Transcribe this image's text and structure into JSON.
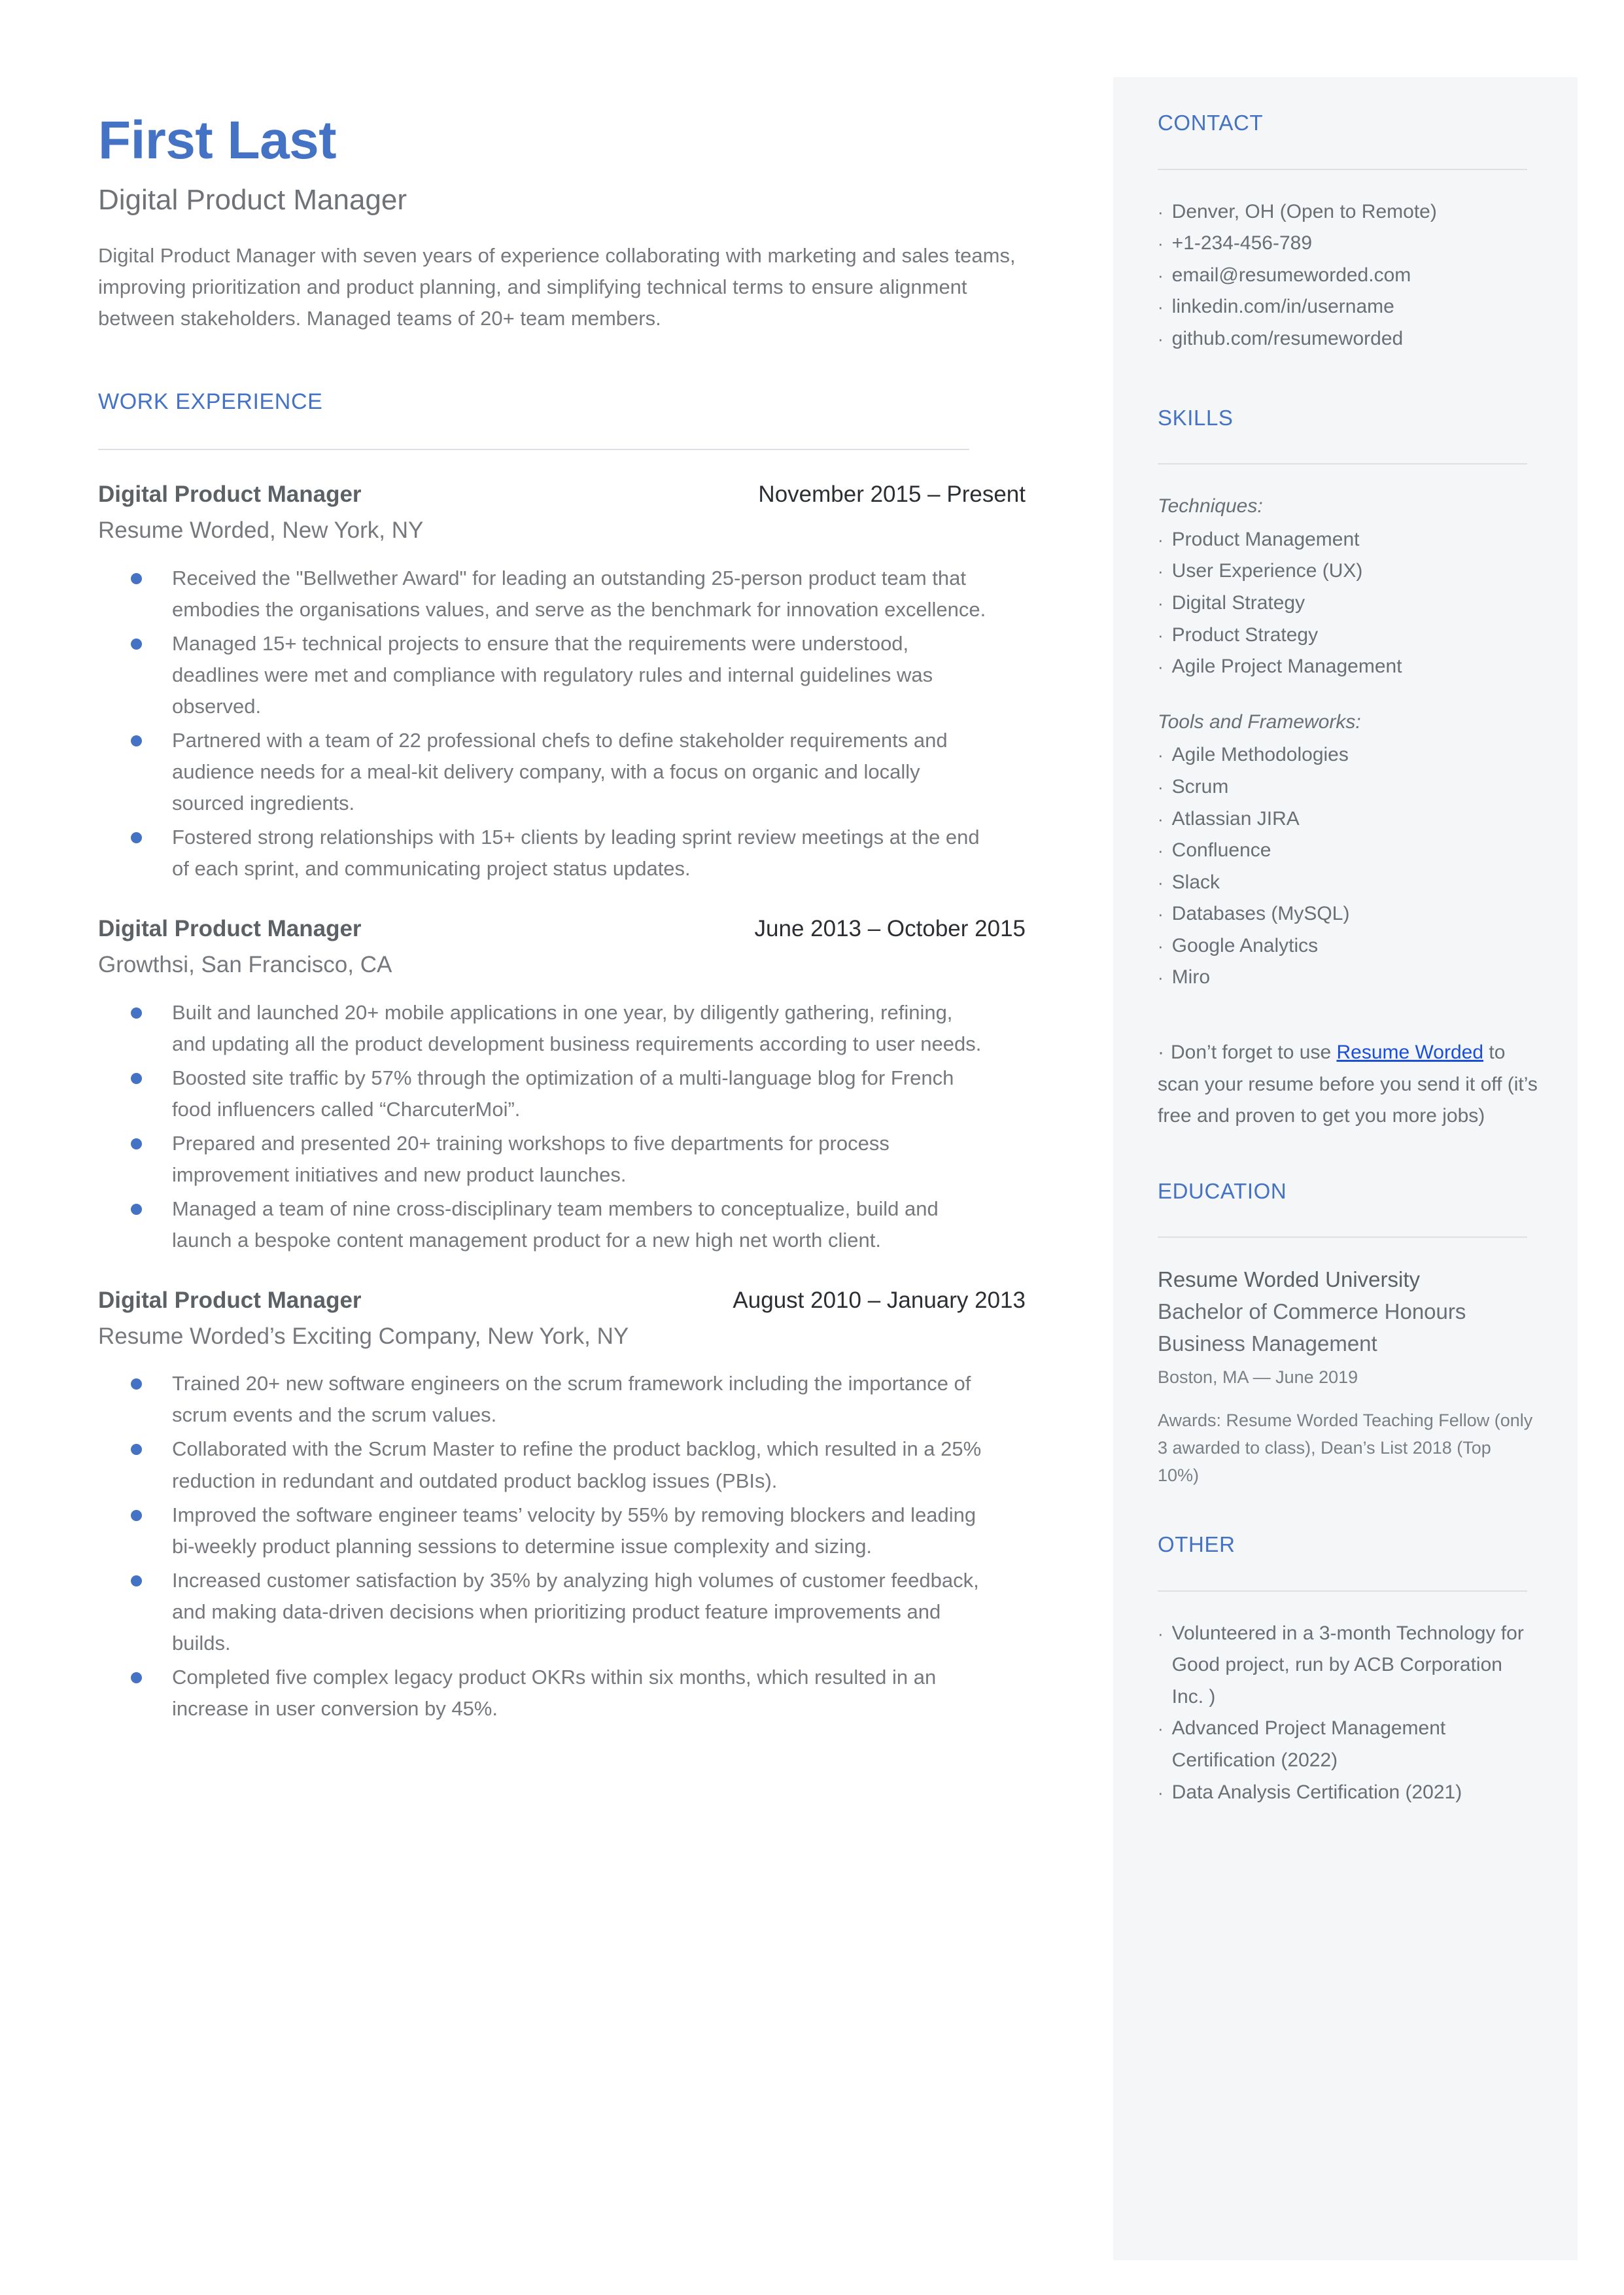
{
  "colors": {
    "accent_blue": "#4472C4",
    "link_blue": "#1A4FD6",
    "body_gray": "#75797E",
    "sidebar_bg": "#F4F6F8",
    "rule_gray": "#DCDFE3"
  },
  "header": {
    "name": "First Last",
    "role": "Digital Product Manager",
    "summary": "Digital Product Manager with seven years of experience collaborating with marketing and sales teams, improving prioritization and product planning, and simplifying technical terms to ensure alignment between stakeholders. Managed teams of 20+ team members."
  },
  "work_experience": {
    "heading": "WORK EXPERIENCE",
    "jobs": [
      {
        "title": "Digital Product Manager",
        "dates": "November 2015 – Present",
        "company": "Resume Worded, New York, NY",
        "bullets": [
          "Received the \"Bellwether Award\" for leading an outstanding 25-person product team that embodies the organisations values, and serve as the benchmark for innovation excellence.",
          "Managed 15+ technical projects to ensure that the requirements were understood, deadlines were met and compliance with regulatory rules and internal guidelines was observed.",
          "Partnered with a team of 22 professional chefs to define stakeholder requirements and audience needs for a meal-kit delivery company, with a focus on organic and locally sourced ingredients.",
          "Fostered strong relationships with 15+ clients by leading sprint review meetings at the end of each sprint, and communicating project status updates."
        ]
      },
      {
        "title": "Digital Product Manager",
        "dates": "June 2013 – October 2015",
        "company": "Growthsi, San Francisco, CA",
        "bullets": [
          "Built and launched 20+ mobile applications in one year, by diligently gathering, refining, and updating all the product development business requirements according to user needs.",
          "Boosted site traffic by 57% through the optimization of a multi-language blog for French food influencers called “CharcuterMoi”.",
          "Prepared and presented 20+ training workshops to five departments for process improvement initiatives and new product launches.",
          "Managed a team of nine cross-disciplinary team members to conceptualize, build and launch a bespoke content management product for a new high net worth client."
        ]
      },
      {
        "title": "Digital Product Manager",
        "dates": "August 2010 – January 2013",
        "company": "Resume Worded’s Exciting Company, New York, NY",
        "bullets": [
          "Trained 20+ new software engineers on the scrum framework including the importance of scrum events and the scrum values.",
          "Collaborated with the Scrum Master to refine the product backlog, which resulted in a 25% reduction in redundant and outdated product backlog issues (PBIs).",
          "Improved the software engineer teams’ velocity by 55% by removing blockers and leading bi-weekly product planning sessions to determine issue complexity and sizing.",
          "Increased customer satisfaction by 35% by analyzing high volumes of customer feedback, and making data-driven decisions when prioritizing product feature improvements and builds.",
          "Completed five complex legacy product OKRs within six months, which resulted in an increase in user conversion by 45%."
        ]
      }
    ]
  },
  "contact": {
    "heading": "CONTACT",
    "items": [
      "Denver, OH (Open to Remote)",
      "+1-234-456-789",
      "email@resumeworded.com",
      "linkedin.com/in/username",
      "github.com/resumeworded"
    ]
  },
  "skills": {
    "heading": "SKILLS",
    "groups": [
      {
        "label": "Techniques:",
        "items": [
          "Product Management",
          "User Experience (UX)",
          "Digital Strategy",
          "Product Strategy",
          "Agile Project Management"
        ]
      },
      {
        "label": "Tools and Frameworks:",
        "items": [
          "Agile Methodologies",
          "Scrum",
          "Atlassian JIRA",
          "Confluence",
          "Slack",
          "Databases (MySQL)",
          "Google Analytics",
          "Miro"
        ]
      }
    ]
  },
  "promo": {
    "bullet": "·",
    "before_link": "Don’t forget to use ",
    "link_text": "Resume Worded",
    "after_link": " to scan your resume before you send it off (it’s free and proven to get you more jobs)"
  },
  "education": {
    "heading": "EDUCATION",
    "school": "Resume Worded University",
    "degree_line1": "Bachelor of Commerce Honours",
    "degree_line2": "Business Management",
    "location_date": "Boston, MA — June 2019",
    "awards": "Awards: Resume Worded Teaching Fellow (only 3 awarded to class), Dean’s List 2018 (Top 10%)"
  },
  "other": {
    "heading": "OTHER",
    "items": [
      "Volunteered in a 3-month Technology for Good project, run by ACB Corporation Inc. )",
      "Advanced Project Management Certification (2022)",
      "Data Analysis Certification (2021)"
    ]
  }
}
